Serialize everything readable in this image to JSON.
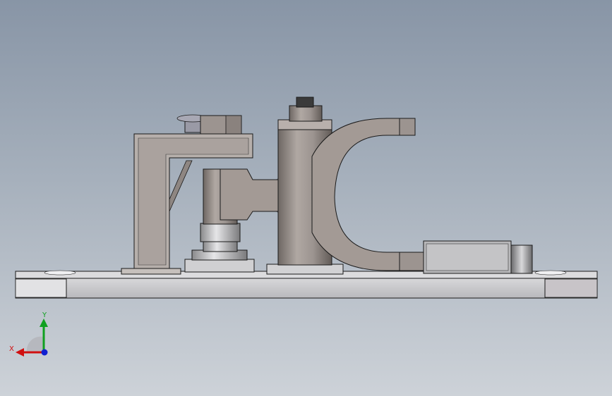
{
  "view": {
    "background_top": "#8895a6",
    "background_bottom": "#cdd2d8"
  },
  "model": {
    "metal_color": "#a39a95",
    "metal_dark": "#7a726e",
    "plate_color": "#c9c9cc",
    "edge_color": "#1a1a1a"
  },
  "triad": {
    "x_label": "X",
    "y_label": "Y",
    "x_color": "#d01010",
    "y_color": "#10a020",
    "z_color": "#1020d0"
  }
}
